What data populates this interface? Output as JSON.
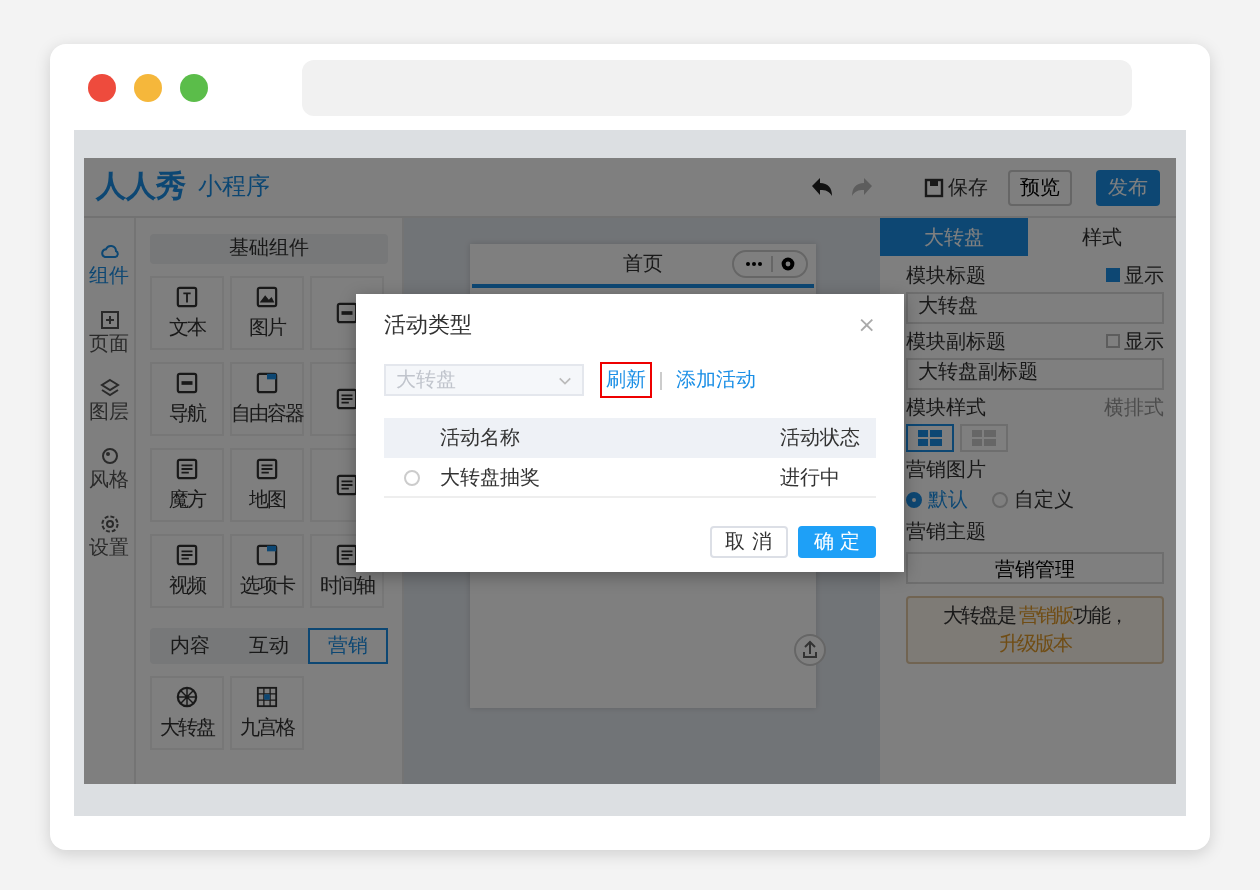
{
  "browser": {
    "dots": [
      {
        "color": "#ee4b3d"
      },
      {
        "color": "#f5b73b"
      },
      {
        "color": "#5bbd4a"
      }
    ]
  },
  "header": {
    "logo": "人人秀",
    "product": "小程序",
    "save": "保存",
    "preview": "预览",
    "publish": "发布"
  },
  "rail": [
    {
      "label": "组件",
      "kind": "cloud",
      "selected": true
    },
    {
      "label": "页面",
      "kind": "page",
      "selected": false
    },
    {
      "label": "图层",
      "kind": "layers",
      "selected": false
    },
    {
      "label": "风格",
      "kind": "palette",
      "selected": false
    },
    {
      "label": "设置",
      "kind": "gear",
      "selected": false
    }
  ],
  "components": {
    "header": "基础组件",
    "items": [
      {
        "label": "文本",
        "kind": "text"
      },
      {
        "label": "图片",
        "kind": "image"
      },
      {
        "kind": "button"
      },
      {
        "label": "导航",
        "kind": "nav"
      },
      {
        "label": "自由容器",
        "kind": "container"
      },
      {
        "kind": "form"
      },
      {
        "label": "魔方",
        "kind": "cube"
      },
      {
        "label": "地图",
        "kind": "map"
      },
      {
        "kind": "notice"
      },
      {
        "label": "视频",
        "kind": "video"
      },
      {
        "label": "选项卡",
        "kind": "tabs"
      },
      {
        "label": "时间轴",
        "kind": "timeline"
      }
    ],
    "tabs": [
      {
        "label": "内容",
        "selected": false
      },
      {
        "label": "互动",
        "selected": false
      },
      {
        "label": "营销",
        "selected": true
      }
    ],
    "marketing_items": [
      {
        "label": "大转盘",
        "kind": "wheel"
      },
      {
        "label": "九宫格",
        "kind": "grid"
      }
    ]
  },
  "canvas": {
    "page_title": "首页"
  },
  "properties": {
    "tabs": [
      {
        "label": "大转盘",
        "selected": true
      },
      {
        "label": "样式",
        "selected": false
      }
    ],
    "title_label": "模块标题",
    "title_show": {
      "label": "显示",
      "checked": true
    },
    "title_value": "大转盘",
    "subtitle_label": "模块副标题",
    "subtitle_show": {
      "label": "显示",
      "checked": false
    },
    "subtitle_value": "大转盘副标题",
    "style_label": "模块样式",
    "style_value": "横排式",
    "style_options": [
      {
        "selected": true
      },
      {
        "selected": false
      }
    ],
    "image_label": "营销图片",
    "image_options": [
      {
        "label": "默认",
        "selected": true
      },
      {
        "label": "自定义",
        "selected": false
      }
    ],
    "theme_label": "营销主题",
    "theme_button": "营销管理",
    "notice": "大转盘是 **营销版**功能，",
    "notice_link": "升级版本"
  },
  "dialog": {
    "title": "活动类型",
    "close": "×",
    "select_placeholder": "大转盘",
    "refresh": "刷新",
    "refresh_highlighted": true,
    "add": "添加活动",
    "columns": [
      "活动名称",
      "活动状态"
    ],
    "rows": [
      {
        "name": "大转盘抽奖",
        "status": "进行中",
        "selected": false
      }
    ],
    "cancel": "取 消",
    "ok": "确 定"
  }
}
